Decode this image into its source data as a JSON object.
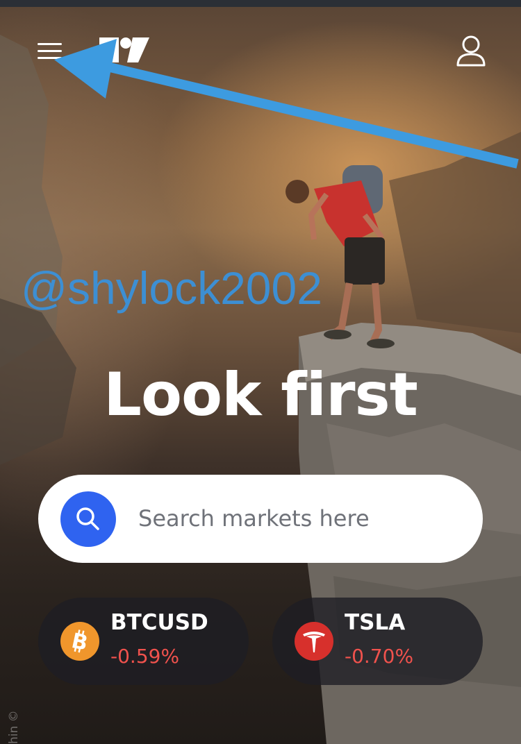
{
  "header": {
    "menu_icon": "hamburger-menu-icon",
    "logo": "tradingview-logo",
    "account_icon": "user-account-icon"
  },
  "watermark": {
    "text": "@shylock2002",
    "color": "#3d8fd3"
  },
  "hero": {
    "headline": "Look first"
  },
  "search": {
    "placeholder": "Search markets here",
    "icon": "search-icon",
    "accent": "#2f63f0"
  },
  "tickers": [
    {
      "symbol": "BTCUSD",
      "change": "-0.59%",
      "icon": "bitcoin-icon",
      "icon_color": "#f0962c"
    },
    {
      "symbol": "TSLA",
      "change": "-0.70%",
      "icon": "tesla-icon",
      "icon_color": "#d7302c"
    }
  ],
  "colors": {
    "negative": "#f0524d",
    "annotation_arrow": "#3d9be0"
  },
  "copyright": {
    "text": "hin ©"
  }
}
